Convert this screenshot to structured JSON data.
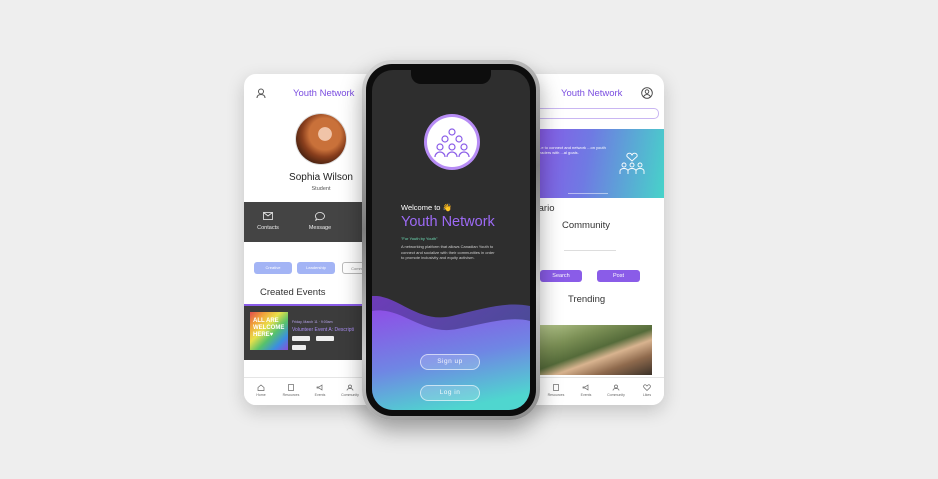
{
  "left_screen": {
    "brand": "Youth Network",
    "profile": {
      "name": "Sophia Wilson",
      "role": "Student"
    },
    "actions": [
      {
        "label": "Contacts",
        "icon": "mail-gear-icon"
      },
      {
        "label": "Message",
        "icon": "chat-bubble-icon"
      },
      {
        "label": "C",
        "icon": "calendar-icon"
      }
    ],
    "chips": [
      "Creative",
      "Leadership",
      "Comm"
    ],
    "section_title": "Created Events",
    "event": {
      "image_text": "ALL ARE WELCOME HERE♥",
      "date": "Friday, March 11 · 9:00am",
      "title": "Volunteer Event A: Descripti"
    },
    "nav": [
      "Home",
      "Resources",
      "Events",
      "Community"
    ]
  },
  "center_phone": {
    "welcome": "Welcome to 👋",
    "title": "Youth Network",
    "tagline": "\"For Youth by Youth\"",
    "description": "A networking platform that allows Canadian Youth to connect and socialize with their communities in order to promote inclusivity and equity activism.",
    "signup": "Sign up",
    "login": "Log in"
  },
  "right_screen": {
    "brand": "Youth Network",
    "banner_text": "...e to connect and network ...on youth leaders with ...al goals.",
    "region": "tario",
    "community_label": "Community",
    "search_button": "Search",
    "post_button": "Post",
    "trending_label": "Trending",
    "nav": [
      "Resources",
      "Events",
      "Community",
      "Likes"
    ]
  },
  "colors": {
    "accent": "#8a5ce8",
    "brand": "#7b4ee0",
    "teal": "#47d3c9",
    "dark": "#2e2e2e"
  }
}
